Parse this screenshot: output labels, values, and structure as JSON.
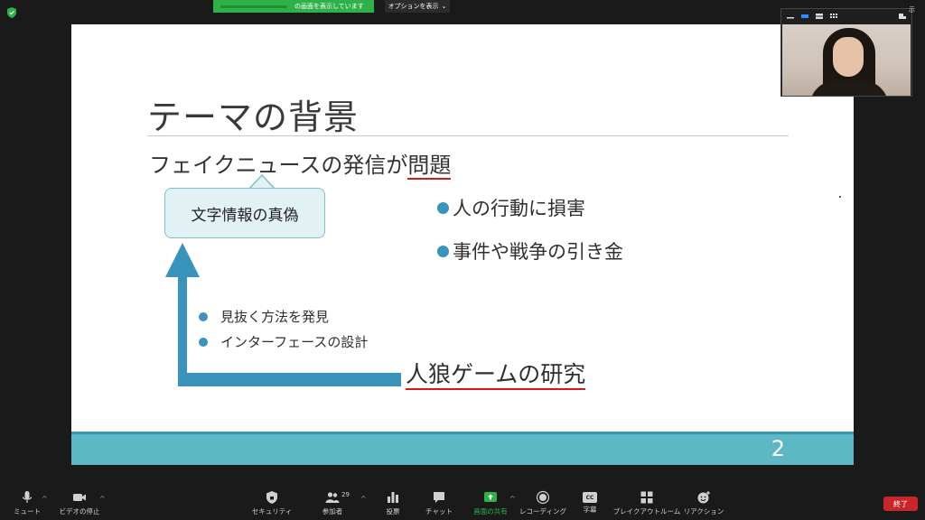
{
  "top": {
    "share_banner_text": "の画面を表示しています",
    "options_label": "オプションを表示",
    "options_caret": "⌄",
    "top_right_label": "示"
  },
  "slide": {
    "title": "テーマの背景",
    "subtitle_prefix": "フェイクニュースの発信が",
    "subtitle_underlined": "問題",
    "callout_text": "文字情報の真偽",
    "right_bullets": [
      "人の行動に損害",
      "事件や戦争の引き金"
    ],
    "left_bullets": [
      "見抜く方法を発見",
      "インターフェースの設計"
    ],
    "research_label": "人狼ゲームの研究",
    "page_number": "2",
    "colors": {
      "accent_blue": "#3a93ba",
      "footer_teal": "#5cb8c2",
      "underline_red": "#d21a1a",
      "callout_fill": "#e2f2f4"
    }
  },
  "toolbar": {
    "mute": "ミュート",
    "stop_video": "ビデオの停止",
    "security": "セキュリティ",
    "participants": "参加者",
    "participants_count": "29",
    "poll": "投票",
    "chat": "チャット",
    "share_screen": "画面の共有",
    "recording": "レコーディング",
    "captions": "字幕",
    "captions_icon_text": "CC",
    "breakout": "ブレイクアウトルーム",
    "reactions": "リアクション",
    "end": "終了",
    "caret": "^"
  },
  "icons": [
    "shield-icon",
    "microphone-icon",
    "video-camera-icon",
    "security-shield-icon",
    "participants-icon",
    "poll-icon",
    "chat-icon",
    "share-screen-icon",
    "record-icon",
    "captions-icon",
    "breakout-rooms-icon",
    "reactions-icon"
  ]
}
